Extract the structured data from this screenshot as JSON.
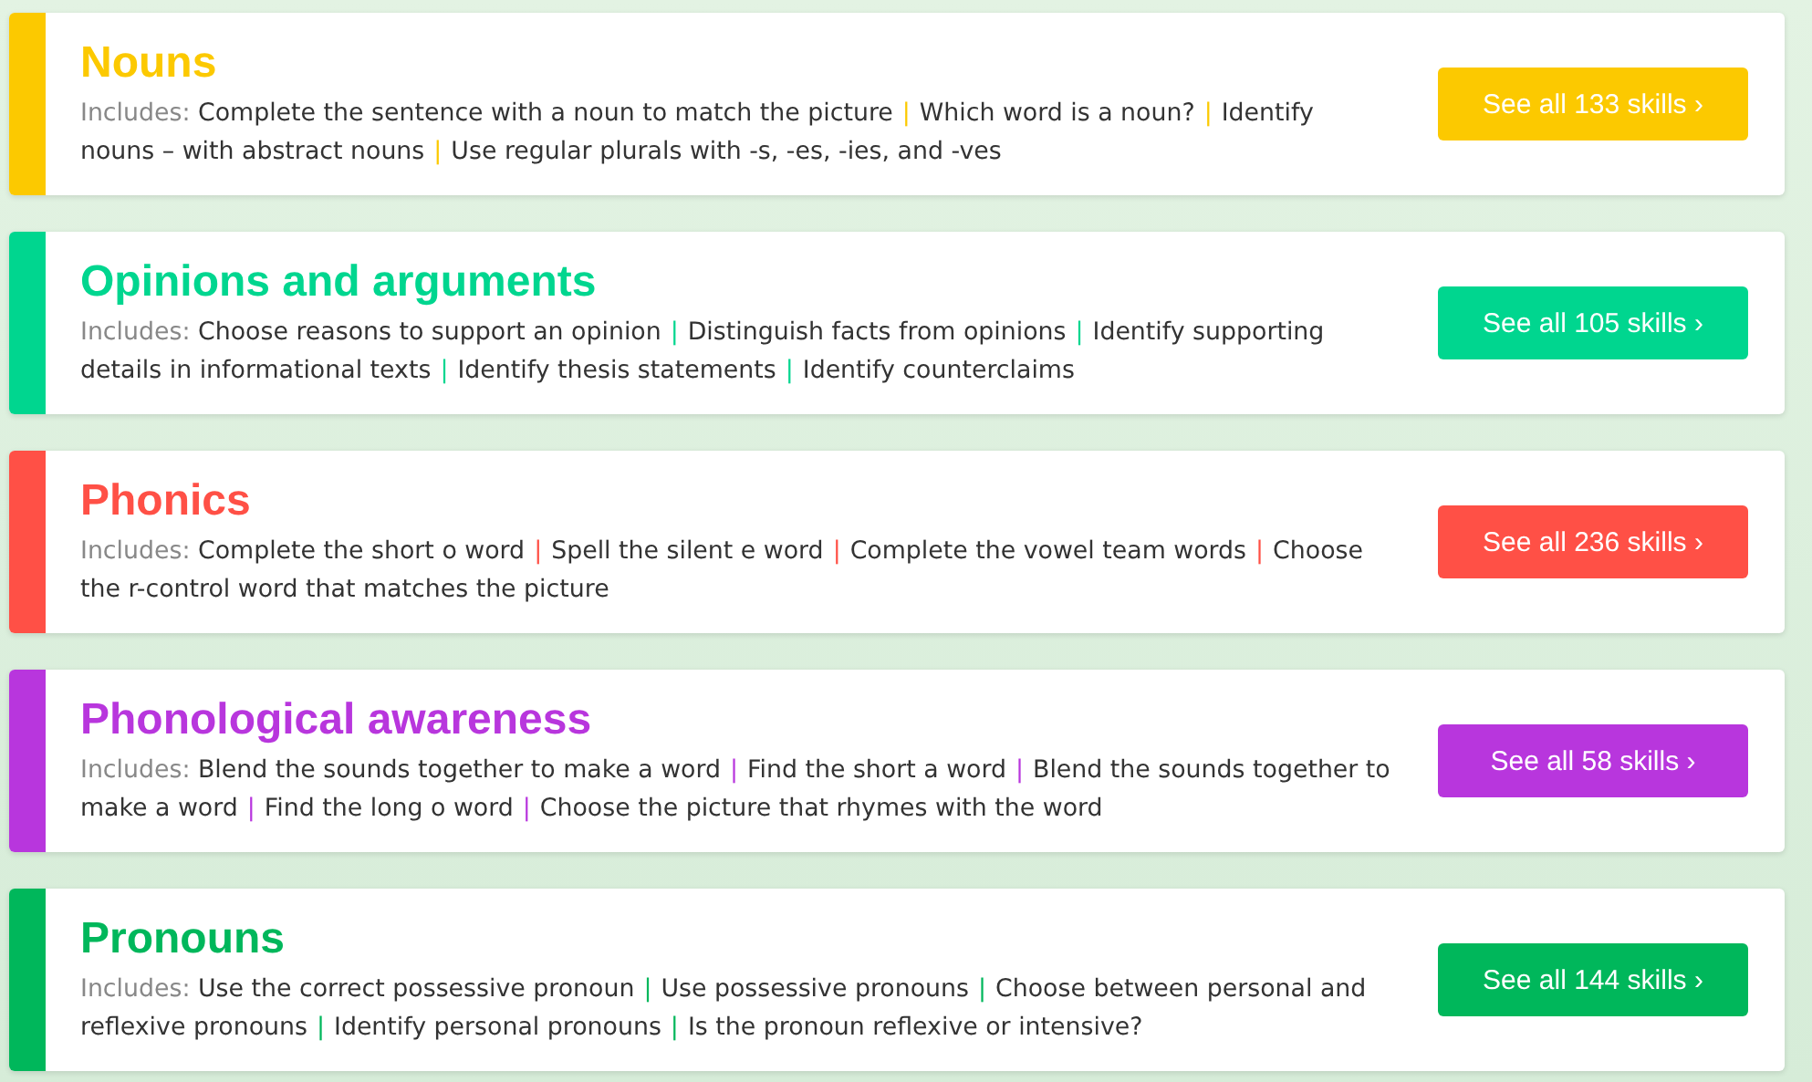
{
  "separator": "|",
  "categories": [
    {
      "title": "Nouns",
      "color": "#fcc900",
      "includes_label": "Includes:",
      "skills": [
        "Complete the sentence with a noun to match the picture",
        "Which word is a noun?",
        "Identify nouns – with abstract nouns",
        "Use regular plurals with -s, -es, -ies, and -ves"
      ],
      "button": "See all 133 skills ›"
    },
    {
      "title": "Opinions and arguments",
      "color": "#00d68f",
      "includes_label": "Includes:",
      "skills": [
        "Choose reasons to support an opinion",
        "Distinguish facts from opinions",
        "Identify supporting details in informational texts",
        "Identify thesis statements",
        "Identify counterclaims"
      ],
      "button": "See all 105 skills ›"
    },
    {
      "title": "Phonics",
      "color": "#ff5046",
      "includes_label": "Includes:",
      "skills": [
        "Complete the short o word",
        "Spell the silent e word",
        "Complete the vowel team words",
        "Choose the r-control word that matches the picture"
      ],
      "button": "See all 236 skills ›"
    },
    {
      "title": "Phonological awareness",
      "color": "#b836dd",
      "includes_label": "Includes:",
      "skills": [
        "Blend the sounds together to make a word",
        "Find the short a word",
        "Blend the sounds together to make a word",
        "Find the long o word",
        "Choose the picture that rhymes with the word"
      ],
      "button": "See all 58 skills ›"
    },
    {
      "title": "Pronouns",
      "color": "#00b75b",
      "includes_label": "Includes:",
      "skills": [
        "Use the correct possessive pronoun",
        "Use possessive pronouns",
        "Choose between personal and reflexive pronouns",
        "Identify personal pronouns",
        "Is the pronoun reflexive or intensive?"
      ],
      "button": "See all 144 skills ›"
    }
  ]
}
